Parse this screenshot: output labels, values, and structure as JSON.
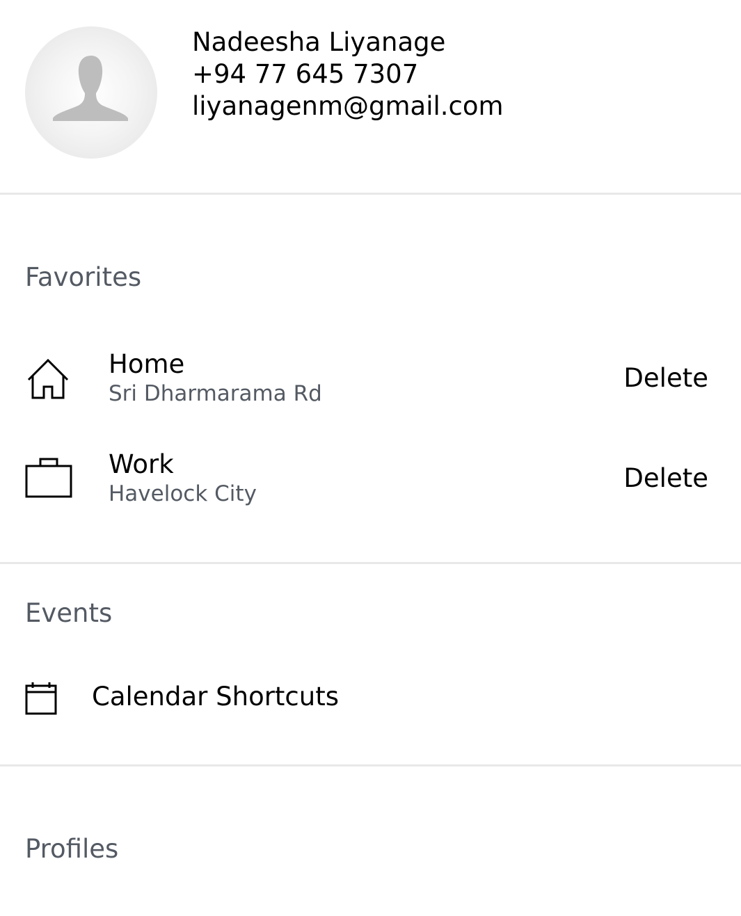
{
  "profile": {
    "name": "Nadeesha Liyanage",
    "phone": "+94 77 645 7307",
    "email": "liyanagenm@gmail.com",
    "avatar_icon": "person-silhouette-icon"
  },
  "favorites": {
    "title": "Favorites",
    "items": [
      {
        "icon": "home-icon",
        "label": "Home",
        "address": "Sri Dharmarama Rd",
        "action": "Delete"
      },
      {
        "icon": "briefcase-icon",
        "label": "Work",
        "address": "Havelock City",
        "action": "Delete"
      }
    ]
  },
  "events": {
    "title": "Events",
    "items": [
      {
        "icon": "calendar-icon",
        "label": "Calendar Shortcuts"
      }
    ]
  },
  "profiles": {
    "title": "Profiles"
  },
  "colors": {
    "section_title": "#545a63",
    "divider": "#e8e8e8",
    "avatar_silhouette": "#bdbdbd"
  }
}
